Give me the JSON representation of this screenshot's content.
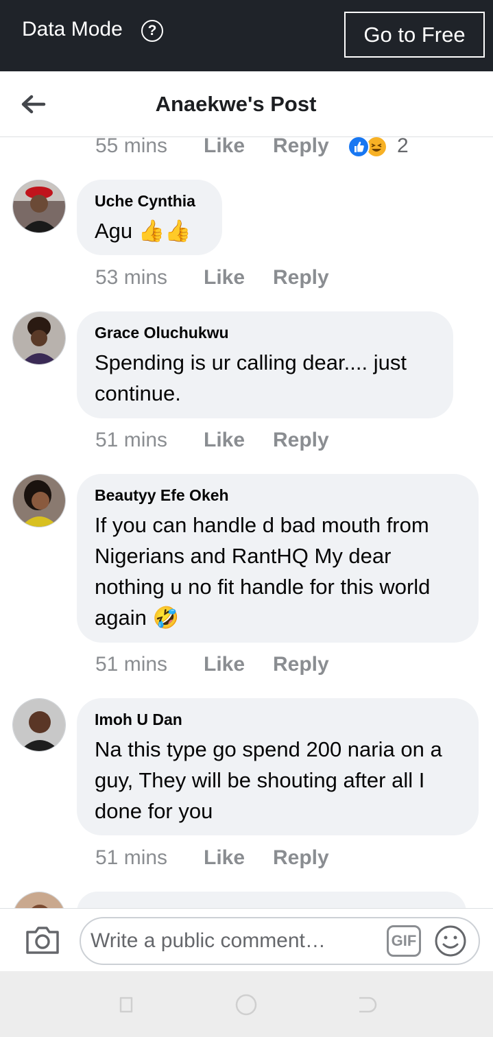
{
  "data_mode": {
    "label": "Data Mode",
    "help_icon": "?",
    "button": "Go to Free"
  },
  "header": {
    "title": "Anaekwe's Post",
    "back_icon": "arrow-left-icon"
  },
  "top_meta": {
    "time": "55 mins",
    "like": "Like",
    "reply": "Reply",
    "reaction_count": "2",
    "reactions": [
      "like",
      "haha"
    ]
  },
  "comments": [
    {
      "name": "Uche Cynthia",
      "text": "Agu 👍👍",
      "time": "53 mins",
      "like": "Like",
      "reply": "Reply"
    },
    {
      "name": "Grace Oluchukwu",
      "text": "Spending is ur calling dear.... just continue.",
      "time": "51 mins",
      "like": "Like",
      "reply": "Reply"
    },
    {
      "name": "Beautyy Efe Okeh",
      "text": "If you can handle d bad mouth from Nigerians and RantHQ My dear nothing u no fit handle for this world again 🤣",
      "time": "51 mins",
      "like": "Like",
      "reply": "Reply"
    },
    {
      "name": "Imoh U Dan",
      "text": "Na this type go spend 200 naria on a guy, They will be shouting after all I done for you",
      "time": "51 mins",
      "like": "Like",
      "reply": "Reply"
    }
  ],
  "composer": {
    "placeholder": "Write a public comment…",
    "gif_label": "GIF"
  },
  "colors": {
    "topbar": "#1f2329",
    "bubble": "#f0f2f5",
    "meta": "#8a8d91",
    "like_reaction": "#1877f2",
    "haha_reaction": "#f7b125"
  }
}
